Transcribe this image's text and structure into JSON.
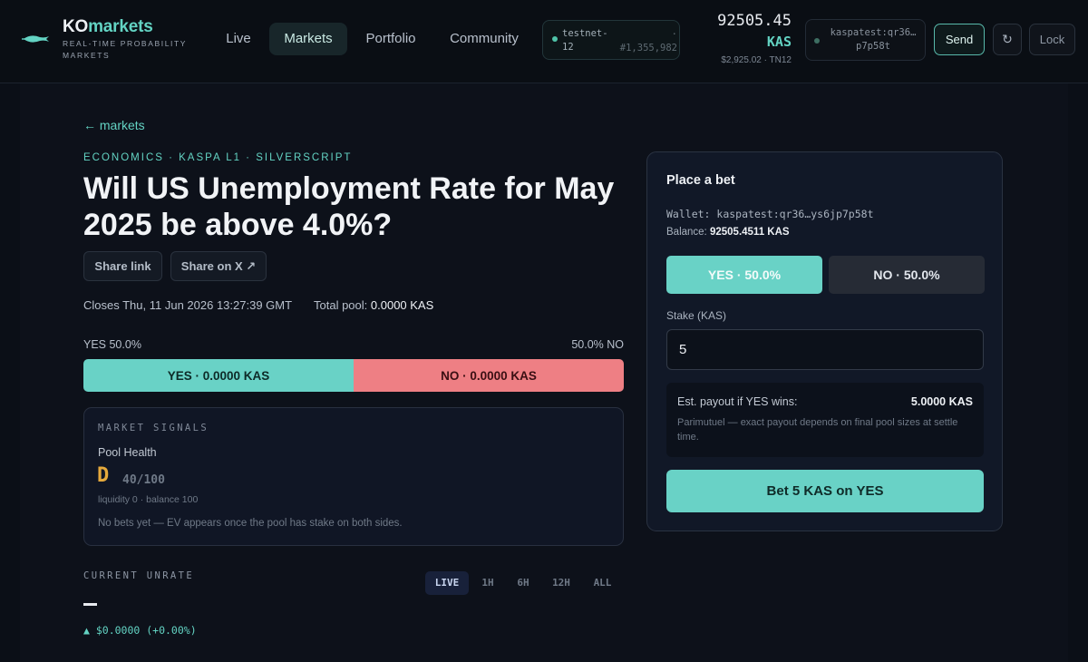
{
  "brand": {
    "name_part1": "KO",
    "name_part2": "markets",
    "tagline": "Real-time probability markets"
  },
  "nav": {
    "items": [
      {
        "label": "Live",
        "active": false
      },
      {
        "label": "Markets",
        "active": true
      },
      {
        "label": "Portfolio",
        "active": false
      },
      {
        "label": "Community",
        "active": false
      }
    ]
  },
  "network": {
    "name": "testnet-12",
    "separator": "·",
    "block": "#1,355,982"
  },
  "wallet_header": {
    "balance": "92505.45",
    "unit": "KAS",
    "usd_network": "$2,925.02 · TN12",
    "address_short": "kaspatest:qr36… p7p58t",
    "send_label": "Send",
    "refresh_label": "↻",
    "lock_label": "Lock"
  },
  "market": {
    "back_label": "← markets",
    "category": "Economics · Kaspa L1 · SilverScript",
    "title": "Will US Unemployment Rate for May 2025 be above 4.0%?",
    "share_link_label": "Share link",
    "share_x_label": "Share on X ↗",
    "closes": "Closes Thu, 11 Jun 2026 13:27:39 GMT",
    "total_pool_label": "Total pool:",
    "total_pool_value": "0.0000 KAS",
    "yes_odds_label": "YES 50.0%",
    "no_odds_label": "50.0% NO",
    "yes_fraction": 0.5,
    "yes_pool_label": "YES · 0.0000 KAS",
    "no_pool_label": "NO · 0.0000 KAS"
  },
  "signals": {
    "heading": "Market Signals",
    "subheading": "Pool Health",
    "grade": "D",
    "score": "40/100",
    "detail": "liquidity 0 · balance 100",
    "note": "No bets yet — EV appears once the pool has stake on both sides."
  },
  "unrate": {
    "label": "Current UNRATE",
    "change": "▲ $0.0000 (+0.00%)",
    "timeframes": [
      {
        "label": "LIVE",
        "active": true
      },
      {
        "label": "1H",
        "active": false
      },
      {
        "label": "6H",
        "active": false
      },
      {
        "label": "12H",
        "active": false
      },
      {
        "label": "ALL",
        "active": false
      }
    ]
  },
  "bet": {
    "title": "Place a bet",
    "wallet_label": "Wallet:",
    "wallet_value": "kaspatest:qr36…ys6jp7p58t",
    "balance_label": "Balance:",
    "balance_value": "92505.4511 KAS",
    "yes_label": "YES · 50.0%",
    "no_label": "NO · 50.0%",
    "stake_label": "Stake (KAS)",
    "stake_value": "5",
    "payout_label": "Est. payout if YES wins:",
    "payout_value": "5.0000 KAS",
    "payout_note": "Parimutuel — exact payout depends on final pool sizes at settle time.",
    "submit_label": "Bet 5 KAS on YES"
  },
  "colors": {
    "accent": "#63d3c3",
    "yes": "#69d2c6",
    "no": "#ee7f84",
    "grade": "#e5a93c"
  }
}
